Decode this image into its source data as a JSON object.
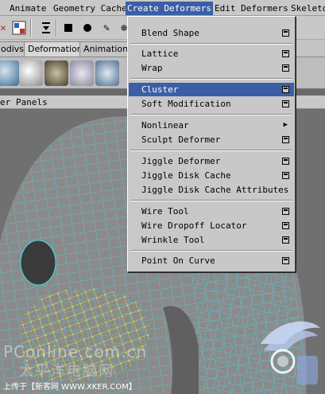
{
  "menubar": {
    "items": [
      {
        "label": "Animate"
      },
      {
        "label": "Geometry Cache"
      },
      {
        "label": "Create Deformers"
      },
      {
        "label": "Edit Deformers"
      },
      {
        "label": "Skeleto"
      }
    ]
  },
  "shelf": {
    "tabs": [
      {
        "label": "odivs"
      },
      {
        "label": "Deformation"
      },
      {
        "label": "Animation"
      }
    ]
  },
  "panelbar": {
    "items": [
      {
        "label": "er"
      },
      {
        "label": "Panels"
      }
    ]
  },
  "dropdown": {
    "items": [
      {
        "label": "Blend Shape",
        "option_box": true
      },
      {
        "label": "Lattice",
        "option_box": true
      },
      {
        "label": "Wrap",
        "option_box": true
      },
      {
        "label": "Cluster",
        "option_box": true,
        "highlighted": true
      },
      {
        "label": "Soft Modification",
        "option_box": true
      },
      {
        "label": "Nonlinear",
        "submenu": true
      },
      {
        "label": "Sculpt Deformer",
        "option_box": true
      },
      {
        "label": "Jiggle Deformer",
        "option_box": true
      },
      {
        "label": "Jiggle Disk Cache",
        "option_box": true
      },
      {
        "label": "Jiggle Disk Cache Attributes"
      },
      {
        "label": "Wire Tool",
        "option_box": true
      },
      {
        "label": "Wire Dropoff Locator",
        "option_box": true
      },
      {
        "label": "Wrinkle Tool",
        "option_box": true
      },
      {
        "label": "Point On Curve",
        "option_box": true
      }
    ]
  },
  "watermark": {
    "text1": "PConline.com.cn",
    "text2": "太平洋电脑网",
    "caption": "上传于【新客网 WWW.XKER.COM】"
  },
  "colors": {
    "menu_bg": "#c8c8c8",
    "highlight": "#3a5fa7",
    "mesh_wire": "#40e0e0",
    "mesh_points": "#c050c0",
    "selected_points": "#e8e840"
  }
}
